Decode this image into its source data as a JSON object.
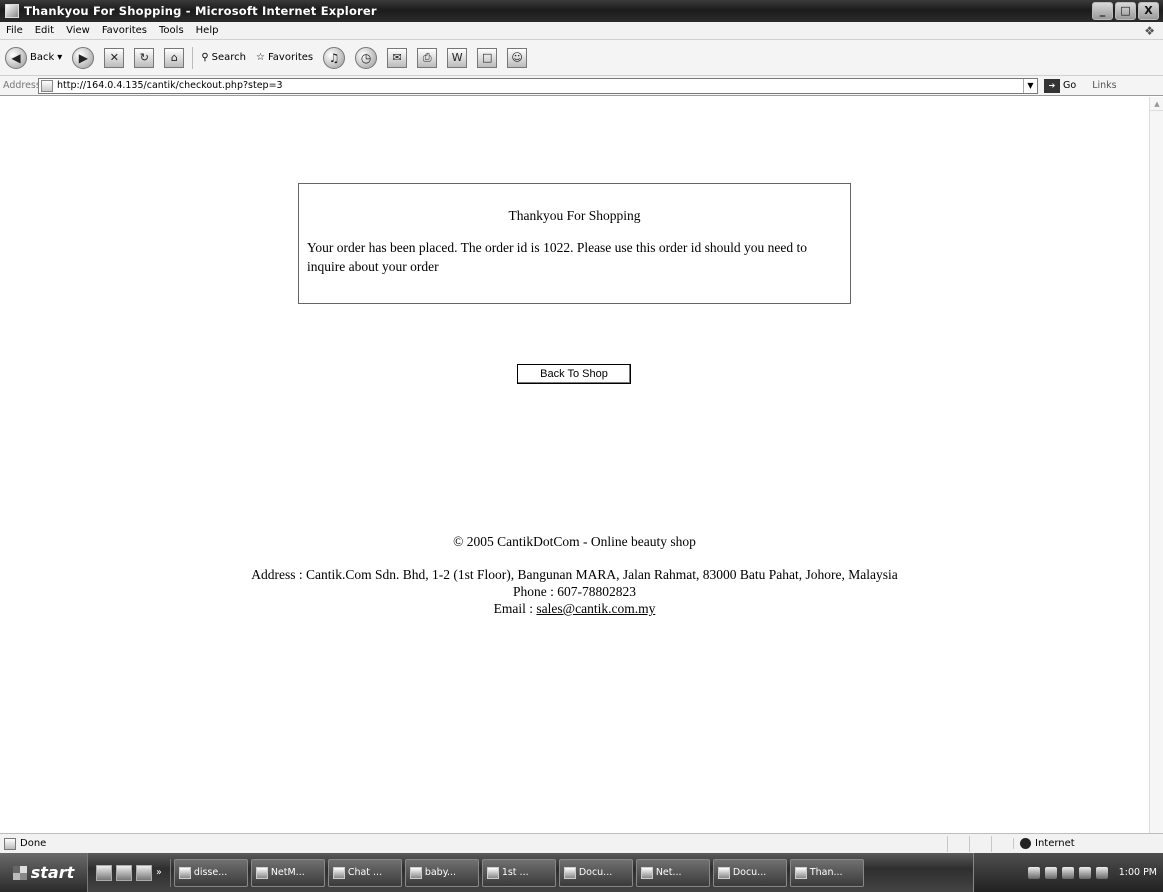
{
  "window": {
    "title": "Thankyou For Shopping - Microsoft Internet Explorer",
    "minimize_glyph": "_",
    "maximize_glyph": "□",
    "close_glyph": "X"
  },
  "menu": {
    "items": [
      "File",
      "Edit",
      "View",
      "Favorites",
      "Tools",
      "Help"
    ]
  },
  "toolbar": {
    "back_label": "Back",
    "search_label": "Search",
    "favorites_label": "Favorites"
  },
  "address": {
    "label": "Address",
    "url": "http://164.0.4.135/cantik/checkout.php?step=3",
    "go_label": "Go",
    "links_label": "Links"
  },
  "page": {
    "message": {
      "title": "Thankyou For Shopping",
      "body": "Your order has been placed. The order id is 1022. Please use this order id should you need to inquire about your order"
    },
    "back_button": "Back To Shop",
    "footer": {
      "copyright": "© 2005 CantikDotCom - Online beauty shop",
      "address": "Address : Cantik.Com Sdn. Bhd, 1-2 (1st Floor), Bangunan MARA, Jalan Rahmat, 83000 Batu Pahat, Johore, Malaysia",
      "phone": "Phone : 607-78802823",
      "email_prefix": "Email : ",
      "email": "sales@cantik.com.my"
    }
  },
  "status": {
    "text": "Done",
    "zone": "Internet"
  },
  "taskbar": {
    "start_label": "start",
    "tasks": [
      "disse...",
      "NetM...",
      "Chat ...",
      "baby...",
      "1st ...",
      "Docu...",
      "Net...",
      "Docu...",
      "Than..."
    ],
    "clock": "1:00 PM"
  },
  "icons": {
    "app": "ie-icon",
    "back": "back-arrow-icon",
    "forward": "forward-arrow-icon",
    "stop": "stop-icon",
    "refresh": "refresh-icon",
    "home": "home-icon",
    "search": "search-icon",
    "favorites": "star-icon",
    "media": "media-icon",
    "history": "history-icon",
    "mail": "mail-icon",
    "print": "print-icon",
    "edit": "edit-icon",
    "discuss": "discuss-icon",
    "messenger": "messenger-icon"
  }
}
